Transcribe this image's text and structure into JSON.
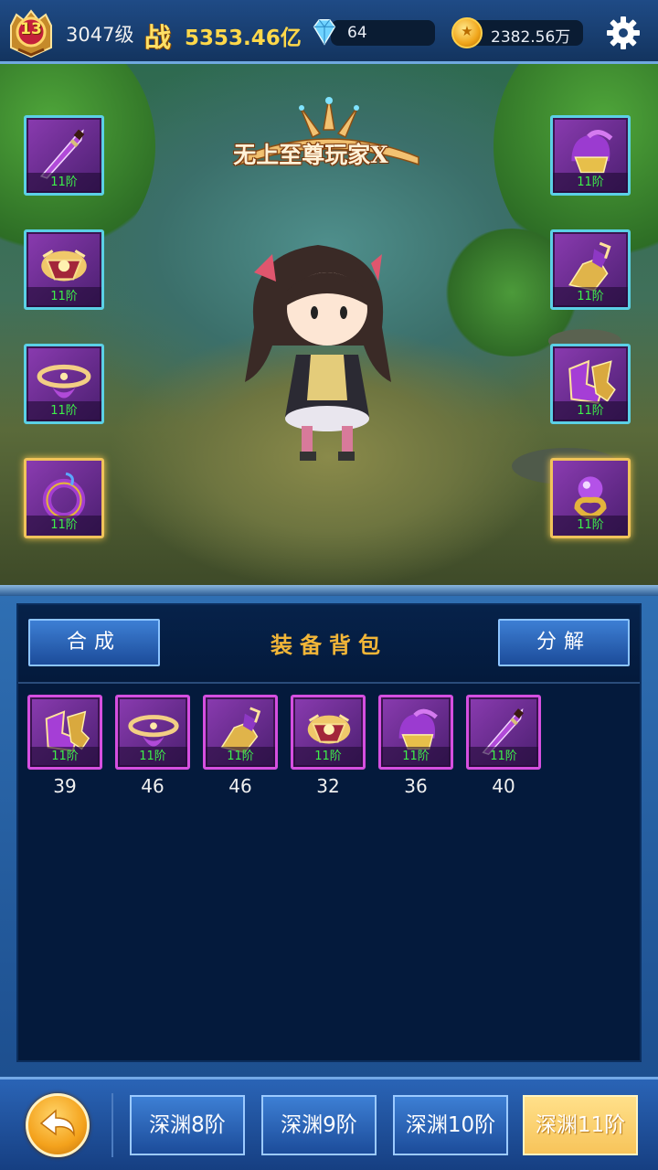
{
  "topbar": {
    "vip_level": "13",
    "player_level": "3047级",
    "power_glyph": "战",
    "power_value": "5353.46亿",
    "gems": "64",
    "gold_glyph": "★",
    "gold": "2382.56万",
    "icons": [
      "vip-badge-icon",
      "diamond-icon",
      "gold-coin-icon",
      "gear-icon"
    ]
  },
  "scene": {
    "player_title": "无上至尊玩家X",
    "left_slots": [
      {
        "item": "purple-sword",
        "tier": "11阶"
      },
      {
        "item": "gold-armor",
        "tier": "11阶"
      },
      {
        "item": "gold-belt",
        "tier": "11阶"
      },
      {
        "item": "purple-amulet",
        "tier": "11阶"
      }
    ],
    "right_slots": [
      {
        "item": "purple-helmet",
        "tier": "11阶"
      },
      {
        "item": "gold-gauntlet",
        "tier": "11阶"
      },
      {
        "item": "gold-boots",
        "tier": "11阶"
      },
      {
        "item": "gem-ring",
        "tier": "11阶"
      }
    ]
  },
  "bag": {
    "combine_label": "合成",
    "title": "装备背包",
    "decompose_label": "分解",
    "items": [
      {
        "item": "gold-boots",
        "tier": "11阶",
        "count": "39"
      },
      {
        "item": "gold-belt",
        "tier": "11阶",
        "count": "46"
      },
      {
        "item": "gold-gauntlet",
        "tier": "11阶",
        "count": "46"
      },
      {
        "item": "gold-armor",
        "tier": "11阶",
        "count": "32"
      },
      {
        "item": "purple-helmet",
        "tier": "11阶",
        "count": "36"
      },
      {
        "item": "purple-sword",
        "tier": "11阶",
        "count": "40"
      }
    ]
  },
  "bottombar": {
    "tabs": [
      "深渊8阶",
      "深渊9阶",
      "深渊10阶",
      "深渊11阶"
    ],
    "active_tab": "深渊11阶"
  },
  "colors": {
    "accent_gold": "#f2b638",
    "tier_green": "#3ef04a",
    "slot_purple": "#d54fe0"
  }
}
